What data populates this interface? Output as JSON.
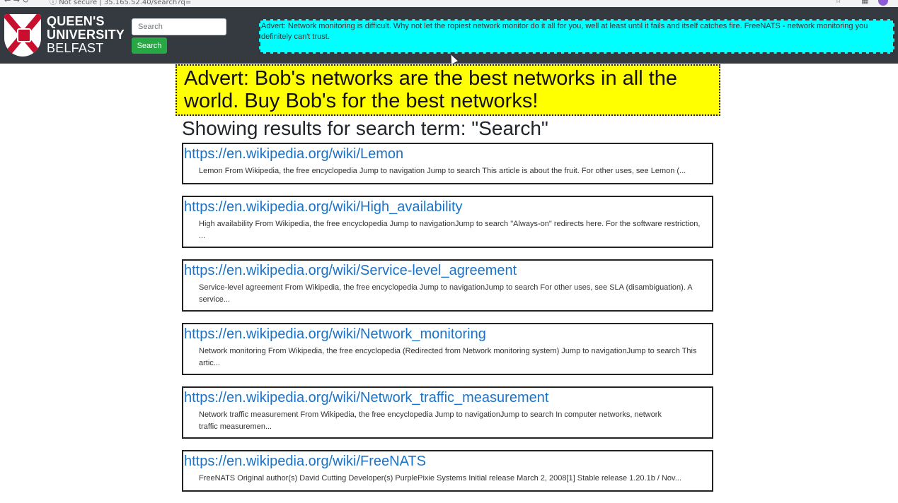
{
  "browser": {
    "url_text": "Not secure | 35.165.52.40/search?q="
  },
  "header": {
    "logo_lines": [
      "QUEEN'S",
      "UNIVERSITY",
      "BELFAST"
    ],
    "search": {
      "placeholder": "Search",
      "button_label": "Search"
    },
    "advert_text": "Advert: Network monitoring is difficult. Why not let the ropiest network monitor do it all for you, well at least until it fails and itself catches fire. FreeNATS - network monitoring you definitely can't trust."
  },
  "main": {
    "advert_text": "Advert: Bob's networks are the best networks in all the world. Buy Bob's for the best networks!",
    "results_heading": "Showing results for search term: \"Search\"",
    "results": [
      {
        "url": "https://en.wikipedia.org/wiki/Lemon",
        "snippet": "Lemon From Wikipedia, the free encyclopedia Jump to navigation Jump to search This article is about the fruit. For other uses, see Lemon (..."
      },
      {
        "url": "https://en.wikipedia.org/wiki/High_availability",
        "snippet": "High availability From Wikipedia, the free encyclopedia Jump to navigationJump to search \"Always-on\" redirects here. For the software restriction, ..."
      },
      {
        "url": "https://en.wikipedia.org/wiki/Service-level_agreement",
        "snippet": "Service-level agreement From Wikipedia, the free encyclopedia Jump to navigationJump to search For other uses, see SLA (disambiguation). A service..."
      },
      {
        "url": "https://en.wikipedia.org/wiki/Network_monitoring",
        "snippet": "Network monitoring From Wikipedia, the free encyclopedia (Redirected from Network monitoring system) Jump to navigationJump to search This artic..."
      },
      {
        "url": "https://en.wikipedia.org/wiki/Network_traffic_measurement",
        "snippet": "Network traffic measurement From Wikipedia, the free encyclopedia Jump to navigationJump to search In computer networks, network traffic measuremen..."
      },
      {
        "url": "https://en.wikipedia.org/wiki/FreeNATS",
        "snippet": "FreeNATS Original author(s) David Cutting Developer(s) PurplePixie Systems Initial release March 2, 2008[1] Stable release 1.20.1b / Nov..."
      }
    ]
  },
  "colors": {
    "navbar": "#343a40",
    "search_button": "#28a745",
    "top_advert_bg": "#00ffff",
    "main_advert_bg": "#ffff00",
    "link": "#1a73c8"
  },
  "icons": [
    "back-icon",
    "forward-icon",
    "reload-icon",
    "info-icon",
    "star-icon",
    "extensions-icon",
    "profile-avatar",
    "university-crest-icon",
    "mouse-cursor"
  ]
}
